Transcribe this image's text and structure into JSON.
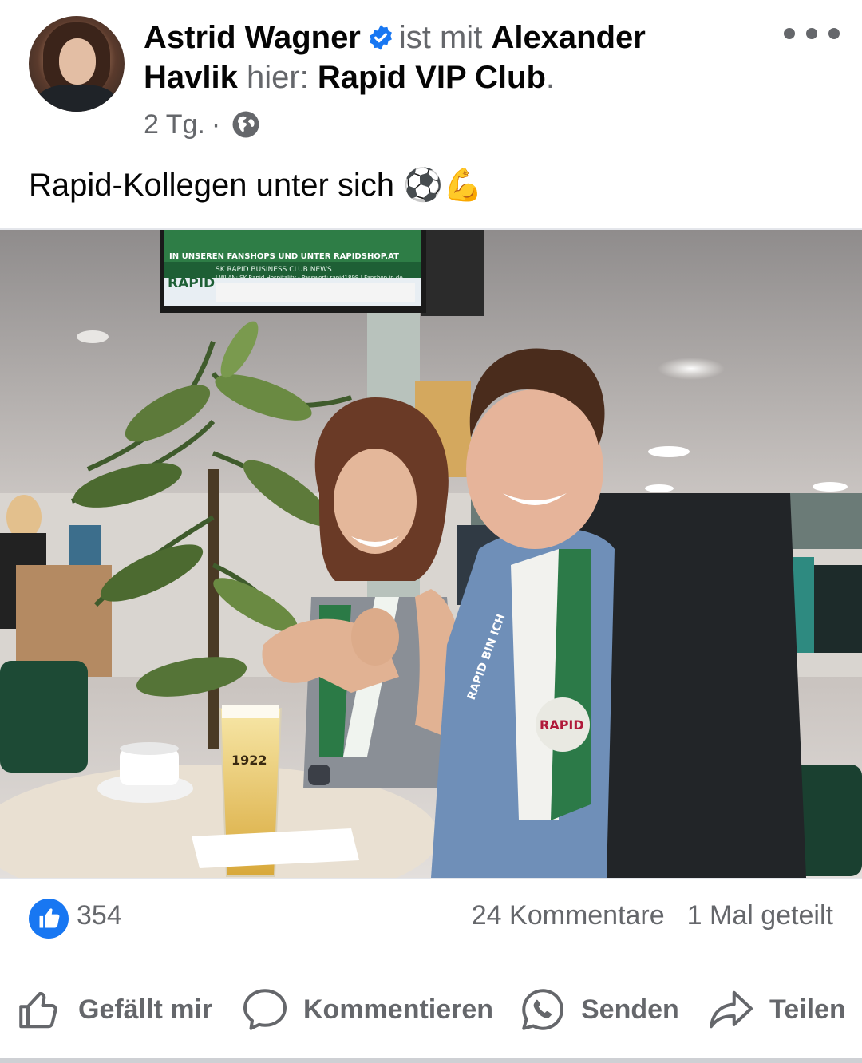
{
  "post": {
    "author": "Astrid Wagner",
    "with_text": "ist mit",
    "tagged": "Alexander",
    "tagged_last": "Havlik",
    "location_prefix": "hier:",
    "location": "Rapid VIP Club",
    "location_suffix": ".",
    "time": "2 Tg.",
    "separator": "·",
    "text": "Rapid-Kollegen unter sich ⚽💪"
  },
  "photo": {
    "tv_line1": "IN UNSEREN FANSHOPS UND UNTER RAPIDSHOP.AT",
    "tv_line2": "SK RAPID BUSINESS CLUB NEWS",
    "tv_line3": "| WLAN: SK Rapid Hospitality - Passwort: rapid1899 | Fanshop in de",
    "tv_logo": "RAPID",
    "scarf_text": "RAPID BIN ICH",
    "scarf_badge": "RAPID",
    "glass_text": "1922"
  },
  "stats": {
    "likes": "354",
    "comments": "24 Kommentare",
    "shares": "1 Mal geteilt"
  },
  "actions": {
    "like": "Gefällt mir",
    "comment": "Kommentieren",
    "send": "Senden",
    "share": "Teilen"
  },
  "colors": {
    "brand_blue": "#1877f2",
    "muted": "#65676b",
    "rapid_green": "#1e7a3c"
  }
}
